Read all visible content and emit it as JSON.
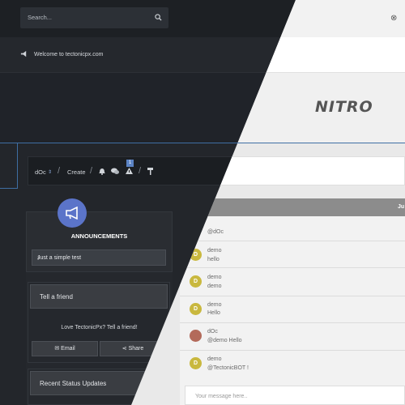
{
  "search": {
    "placeholder": "Search..."
  },
  "welcome": {
    "text": "Welcome to tectonicpx.com"
  },
  "logo": {
    "text": "NITRO"
  },
  "usernav": {
    "username": "dOc",
    "create_label": "Create",
    "notification_count": "1"
  },
  "announcements": {
    "title": "ANNOUNCEMENTS",
    "item": "Just a simple test"
  },
  "tell_friend": {
    "title": "Tell a friend",
    "text": "Love TectonicPx? Tell a friend!",
    "email_label": "Email",
    "share_label": "Share"
  },
  "status_updates": {
    "title": "Recent Status Updates"
  },
  "chat": {
    "header": "Ju",
    "input_placeholder": "Your message here..",
    "messages": [
      {
        "name": "",
        "text": "@dOc"
      },
      {
        "name": "demo",
        "text": "hello"
      },
      {
        "name": "demo",
        "text": "demo"
      },
      {
        "name": "demo",
        "text": "Hello"
      },
      {
        "name": "dOc",
        "text": "@demo Hello"
      },
      {
        "name": "demo",
        "text": "@TectonicBOT !"
      }
    ]
  },
  "colors": {
    "accent_blue": "#5b74c9",
    "dark_bg": "#23262b",
    "light_bg": "#e9e9e9",
    "avatar_demo": "#c9b83e"
  }
}
